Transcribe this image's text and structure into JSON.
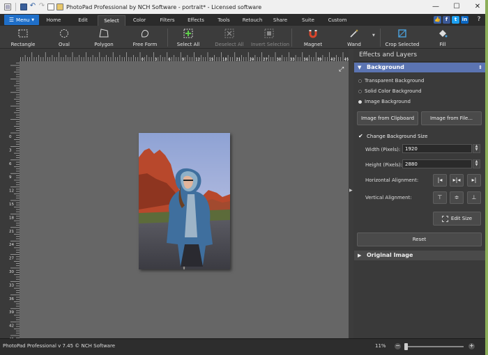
{
  "window": {
    "title": "PhotoPad Professional by NCH Software - portrait* - Licensed software",
    "minimize": "—",
    "maximize": "☐",
    "close": "✕"
  },
  "menu": {
    "menu_label": "Menu",
    "tabs": [
      "Home",
      "Edit",
      "Select",
      "Color",
      "Filters",
      "Effects",
      "Tools",
      "Retouch",
      "Share",
      "Suite",
      "Custom"
    ],
    "active_tab": "Select",
    "help": "?"
  },
  "toolbar": {
    "tools": [
      {
        "label": "Rectangle",
        "icon": "rectangle-select-icon"
      },
      {
        "label": "Oval",
        "icon": "oval-select-icon"
      },
      {
        "label": "Polygon",
        "icon": "polygon-select-icon"
      },
      {
        "label": "Free Form",
        "icon": "freeform-select-icon"
      },
      {
        "label": "Select All",
        "icon": "select-all-icon"
      },
      {
        "label": "Deselect All",
        "icon": "deselect-all-icon"
      },
      {
        "label": "Invert Selection",
        "icon": "invert-selection-icon"
      },
      {
        "label": "Magnet",
        "icon": "magnet-icon"
      },
      {
        "label": "Wand",
        "icon": "wand-icon"
      },
      {
        "label": "Crop Selected",
        "icon": "crop-icon"
      },
      {
        "label": "Fill",
        "icon": "fill-icon"
      }
    ]
  },
  "ruler": {
    "top": [
      "0",
      "3",
      "6",
      "9",
      "12",
      "15",
      "18",
      "21",
      "24",
      "27",
      "30",
      "33",
      "36",
      "39",
      "42",
      "45"
    ],
    "left": [
      "0",
      "3",
      "6",
      "9",
      "12",
      "15",
      "18",
      "21",
      "24",
      "27",
      "30",
      "33",
      "36",
      "39",
      "42",
      "45"
    ]
  },
  "panel": {
    "title": "Effects and Layers",
    "background_section": "Background",
    "options": [
      "Transparent Background",
      "Solid Color Background",
      "Image Background"
    ],
    "selected_option": "Image Background",
    "image_from_clipboard": "Image from Clipboard",
    "image_from_file": "Image from File...",
    "change_size_label": "Change Background Size",
    "width_label": "Width (Pixels):",
    "width_value": "1920",
    "height_label": "Height (Pixels):",
    "height_value": "2880",
    "horizontal_alignment": "Horizontal Alignment:",
    "vertical_alignment": "Vertical Alignment:",
    "edit_size": "Edit Size",
    "reset": "Reset",
    "original_image_section": "Original Image"
  },
  "status": {
    "text": "PhotoPad Professional v 7.45 © NCH Software",
    "zoom": "11%"
  },
  "colors": {
    "accent_blue": "#1f6fc9",
    "section_header": "#5b74b2",
    "canvas_bg": "#666666"
  }
}
